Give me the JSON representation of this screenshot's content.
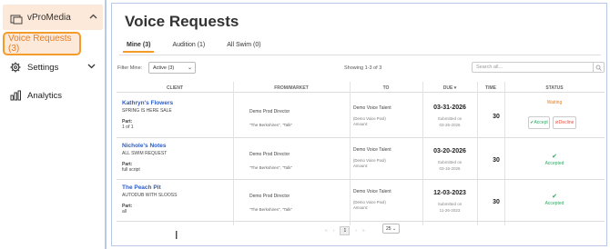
{
  "sidebar": {
    "brand": "vProMedia",
    "voice_requests": "Voice Requests (3)",
    "settings": "Settings",
    "analytics": "Analytics"
  },
  "main": {
    "title": "Voice Requests",
    "tabs": [
      {
        "label": "Mine (3)",
        "active": true
      },
      {
        "label": "Audition (1)",
        "active": false
      },
      {
        "label": "All Swim (0)",
        "active": false
      }
    ],
    "filter_label": "Filter Mine:",
    "filter_value": "Active (3)",
    "showing": "Showing 1-3 of 3",
    "search_placeholder": "Search all..."
  },
  "table": {
    "headers": [
      "CLIENT",
      "FROM/MARKET",
      "TO",
      "DUE",
      "TIME",
      "STATUS"
    ],
    "rows": [
      {
        "client": "Kathryn's Flowers",
        "subtitle": "SPRING IS HERE SALE",
        "part_label": "Part:",
        "part": "1 of 1",
        "from": "Demo Prod Director",
        "from_sub": "\"The Berkshires\", \"Talk\"",
        "to": "Demo Voice Talent",
        "to_sub1": "(Demo Voice Pool)",
        "to_sub2": "Amount:",
        "due": "03-31-2026",
        "submitted_label": "Submitted on",
        "submitted": "03-26-2026",
        "time": "30",
        "status": "Waiting",
        "accept": "Accept",
        "decline": "Decline"
      },
      {
        "client": "Nichole's Notes",
        "subtitle": "ALL SWIM REQUEST",
        "part_label": "Part:",
        "part": "full script",
        "from": "Demo Prod Director",
        "from_sub": "\"The Berkshires\", \"Talk\"",
        "to": "Demo Voice Talent",
        "to_sub1": "(Demo Voice Pool)",
        "to_sub2": "Amount:",
        "due": "03-20-2026",
        "submitted_label": "Submitted on",
        "submitted": "03-16-2026",
        "time": "30",
        "status": "Accepted"
      },
      {
        "client": "The Peach Pit",
        "subtitle": "AUTODUB WITH SLOOSS",
        "part_label": "Part:",
        "part": "all",
        "from": "Demo Prod Director",
        "from_sub": "\"The Berkshires\", \"Talk\"",
        "to": "Demo Voice Talent",
        "to_sub1": "(Demo Voice Pool)",
        "to_sub2": "Amount:",
        "due": "12-03-2023",
        "submitted_label": "Submitted on",
        "submitted": "11-26-2023",
        "time": "30",
        "status": "Accepted"
      }
    ]
  },
  "pagination": {
    "current": "1",
    "page_size": "25"
  }
}
